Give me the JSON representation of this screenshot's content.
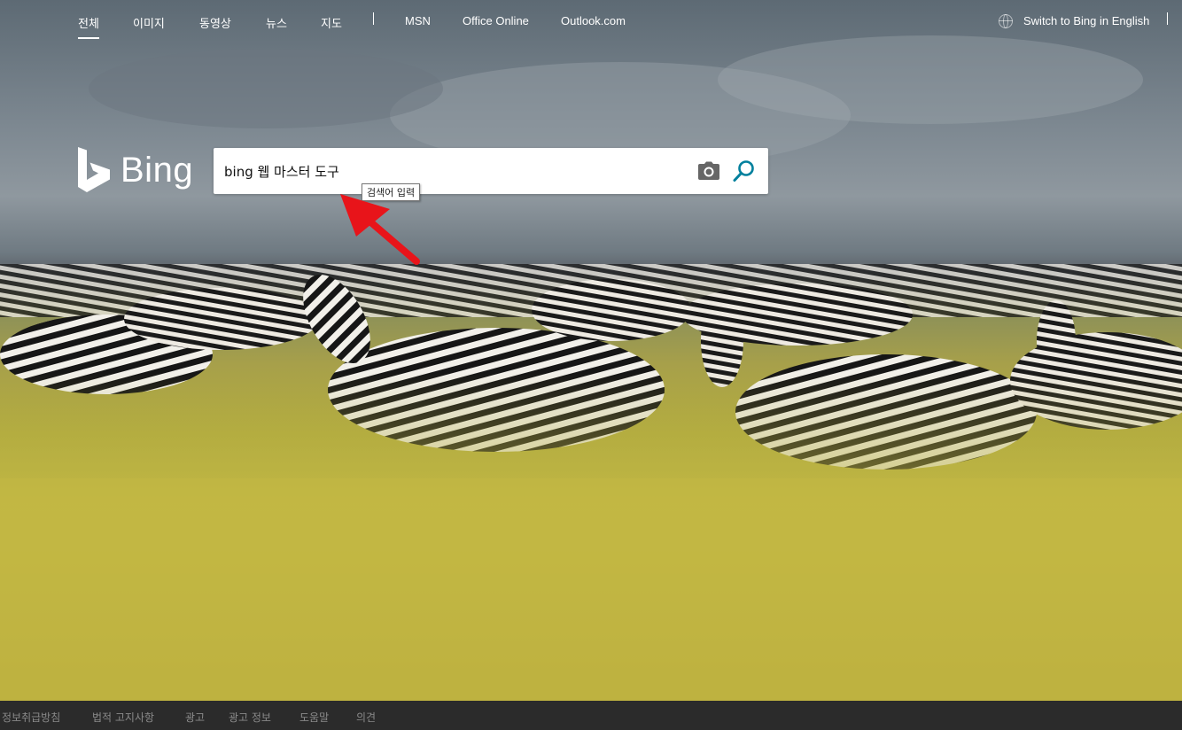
{
  "nav": {
    "items": [
      {
        "label": "전체",
        "active": true
      },
      {
        "label": "이미지"
      },
      {
        "label": "동영상"
      },
      {
        "label": "뉴스"
      },
      {
        "label": "지도"
      }
    ],
    "links": [
      {
        "label": "MSN"
      },
      {
        "label": "Office Online"
      },
      {
        "label": "Outlook.com"
      }
    ],
    "language_switch": "Switch to Bing in English"
  },
  "logo": {
    "text": "Bing"
  },
  "search": {
    "value": "bing 웹 마스터 도구",
    "tooltip": "검색어 입력",
    "camera_icon": "camera-icon",
    "search_icon": "search-icon",
    "search_icon_color": "#00809d"
  },
  "annotation": {
    "arrow_color": "#e8141a"
  },
  "footer": {
    "links": [
      "정보취급방침",
      "법적 고지사항",
      "광고",
      "광고 정보",
      "도움말",
      "의견"
    ]
  }
}
